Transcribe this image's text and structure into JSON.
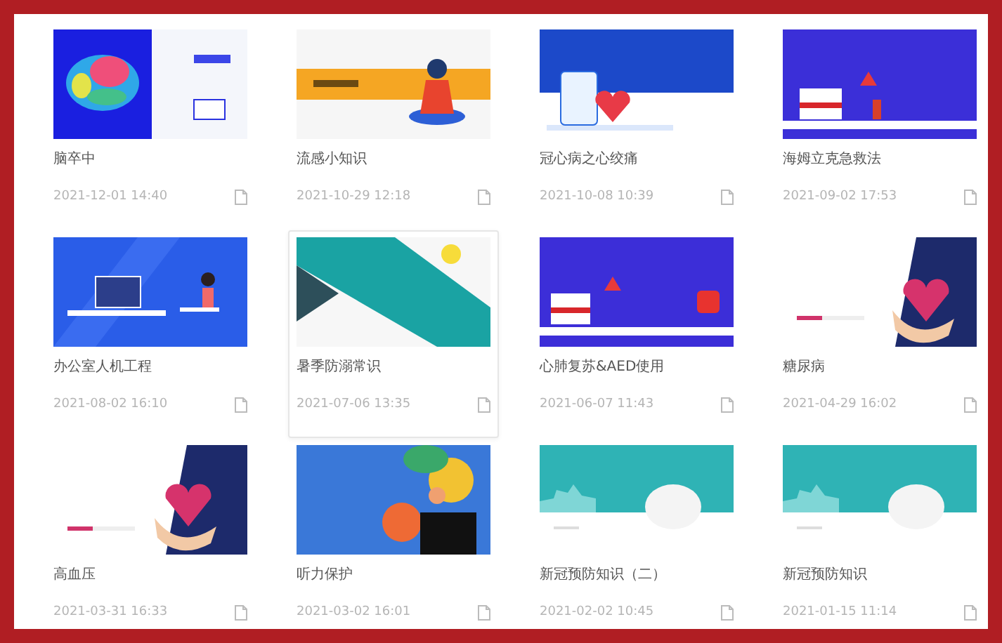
{
  "courses": [
    {
      "title": "脑卒中",
      "date": "2021-12-01 14:40",
      "selected": false
    },
    {
      "title": "流感小知识",
      "date": "2021-10-29 12:18",
      "selected": false
    },
    {
      "title": "冠心病之心绞痛",
      "date": "2021-10-08 10:39",
      "selected": false
    },
    {
      "title": "海姆立克急救法",
      "date": "2021-09-02 17:53",
      "selected": false
    },
    {
      "title": "办公室人机工程",
      "date": "2021-08-02 16:10",
      "selected": false
    },
    {
      "title": "暑季防溺常识",
      "date": "2021-07-06 13:35",
      "selected": true
    },
    {
      "title": "心肺复苏&AED使用",
      "date": "2021-06-07 11:43",
      "selected": false
    },
    {
      "title": "糖尿病",
      "date": "2021-04-29 16:02",
      "selected": false
    },
    {
      "title": "高血压",
      "date": "2021-03-31 16:33",
      "selected": false
    },
    {
      "title": "听力保护",
      "date": "2021-03-02 16:01",
      "selected": false
    },
    {
      "title": "新冠预防知识（二）",
      "date": "2021-02-02 10:45",
      "selected": false
    },
    {
      "title": "新冠预防知识",
      "date": "2021-01-15 11:14",
      "selected": false
    }
  ]
}
